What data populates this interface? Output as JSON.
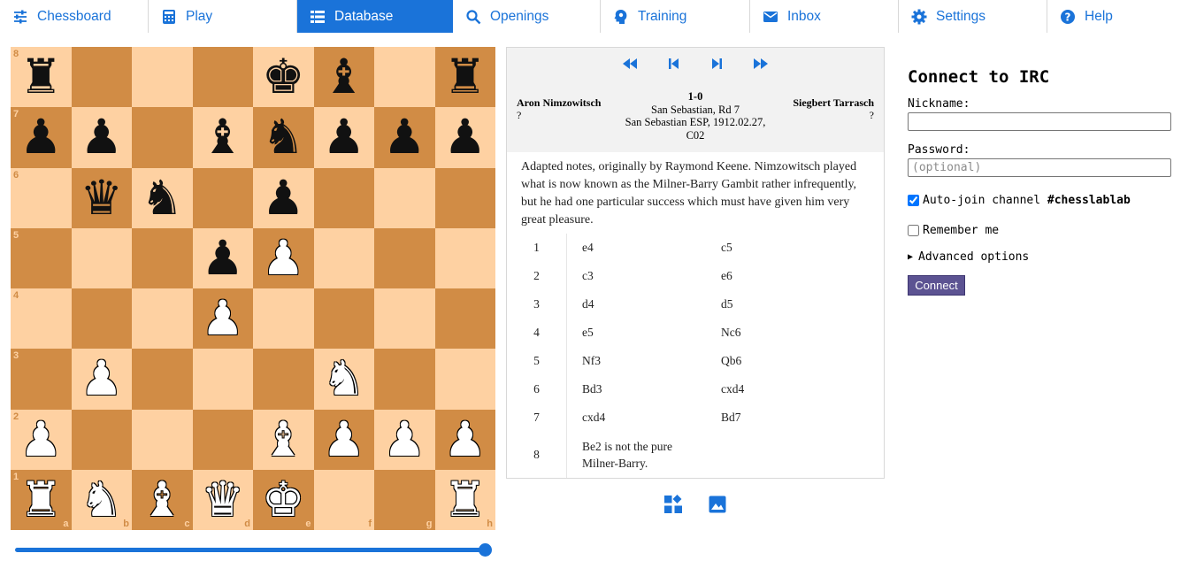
{
  "nav": {
    "items": [
      {
        "label": "Chessboard",
        "icon": "sliders-icon"
      },
      {
        "label": "Play",
        "icon": "calculator-icon"
      },
      {
        "label": "Database",
        "icon": "list-icon",
        "active": true
      },
      {
        "label": "Openings",
        "icon": "search-icon"
      },
      {
        "label": "Training",
        "icon": "brain-icon"
      },
      {
        "label": "Inbox",
        "icon": "envelope-icon"
      },
      {
        "label": "Settings",
        "icon": "gear-icon"
      },
      {
        "label": "Help",
        "icon": "help-icon"
      }
    ],
    "accent": "#1a73d9"
  },
  "board": {
    "ranks": [
      "8",
      "7",
      "6",
      "5",
      "4",
      "3",
      "2",
      "1"
    ],
    "files": [
      "a",
      "b",
      "c",
      "d",
      "e",
      "f",
      "g",
      "h"
    ],
    "light_color": "#fed1a2",
    "dark_color": "#d18c45",
    "position": [
      [
        "br",
        "",
        "",
        "",
        "bk",
        "bb",
        "",
        "br"
      ],
      [
        "bp",
        "bp",
        "",
        "bb",
        "bn",
        "bp",
        "bp",
        "bp"
      ],
      [
        "",
        "bq",
        "bn",
        "",
        "bp",
        "",
        "",
        ""
      ],
      [
        "",
        "",
        "",
        "bp",
        "wp",
        "",
        "",
        ""
      ],
      [
        "",
        "",
        "",
        "wp",
        "",
        "",
        "",
        ""
      ],
      [
        "",
        "wp",
        "",
        "",
        "",
        "wn",
        "",
        ""
      ],
      [
        "wp",
        "",
        "",
        "",
        "wb",
        "wp",
        "wp",
        "wp"
      ],
      [
        "wr",
        "wn",
        "wb",
        "wq",
        "wk",
        "",
        "",
        "wr"
      ]
    ]
  },
  "slider": {
    "position_fraction": 1.0
  },
  "game": {
    "white_name": "Aron Nimzowitsch",
    "white_rating": "?",
    "black_name": "Siegbert Tarrasch",
    "black_rating": "?",
    "result": "1-0",
    "event": "San Sebastian, Rd 7",
    "site_date": "San Sebastian ESP, 1912.02.27,",
    "eco": "C02",
    "annotation": "Adapted notes, originally by Raymond Keene. Nimzowitsch played what is now known as the Milner-Barry Gambit rather infrequently, but he had one particular success which must have given him very great pleasure.",
    "moves": [
      {
        "num": "1",
        "white": "e4",
        "black": "c5"
      },
      {
        "num": "2",
        "white": "c3",
        "black": "e6"
      },
      {
        "num": "3",
        "white": "d4",
        "black": "d5"
      },
      {
        "num": "4",
        "white": "e5",
        "black": "Nc6"
      },
      {
        "num": "5",
        "white": "Nf3",
        "black": "Qb6"
      },
      {
        "num": "6",
        "white": "Bd3",
        "black": "cxd4"
      },
      {
        "num": "7",
        "white": "cxd4",
        "black": "Bd7"
      },
      {
        "num": "8",
        "white": "Be2 is not the pure Milner-Barry.",
        "black": ""
      }
    ]
  },
  "irc": {
    "title": "Connect to IRC",
    "nickname_label": "Nickname:",
    "nickname_value": "",
    "password_label": "Password:",
    "password_placeholder": "(optional)",
    "autojoin_prefix": "Auto-join channel ",
    "autojoin_channel": "#chesslablab",
    "autojoin_checked": true,
    "remember_label": "Remember me",
    "remember_checked": false,
    "advanced_label": "Advanced options",
    "connect_label": "Connect"
  }
}
